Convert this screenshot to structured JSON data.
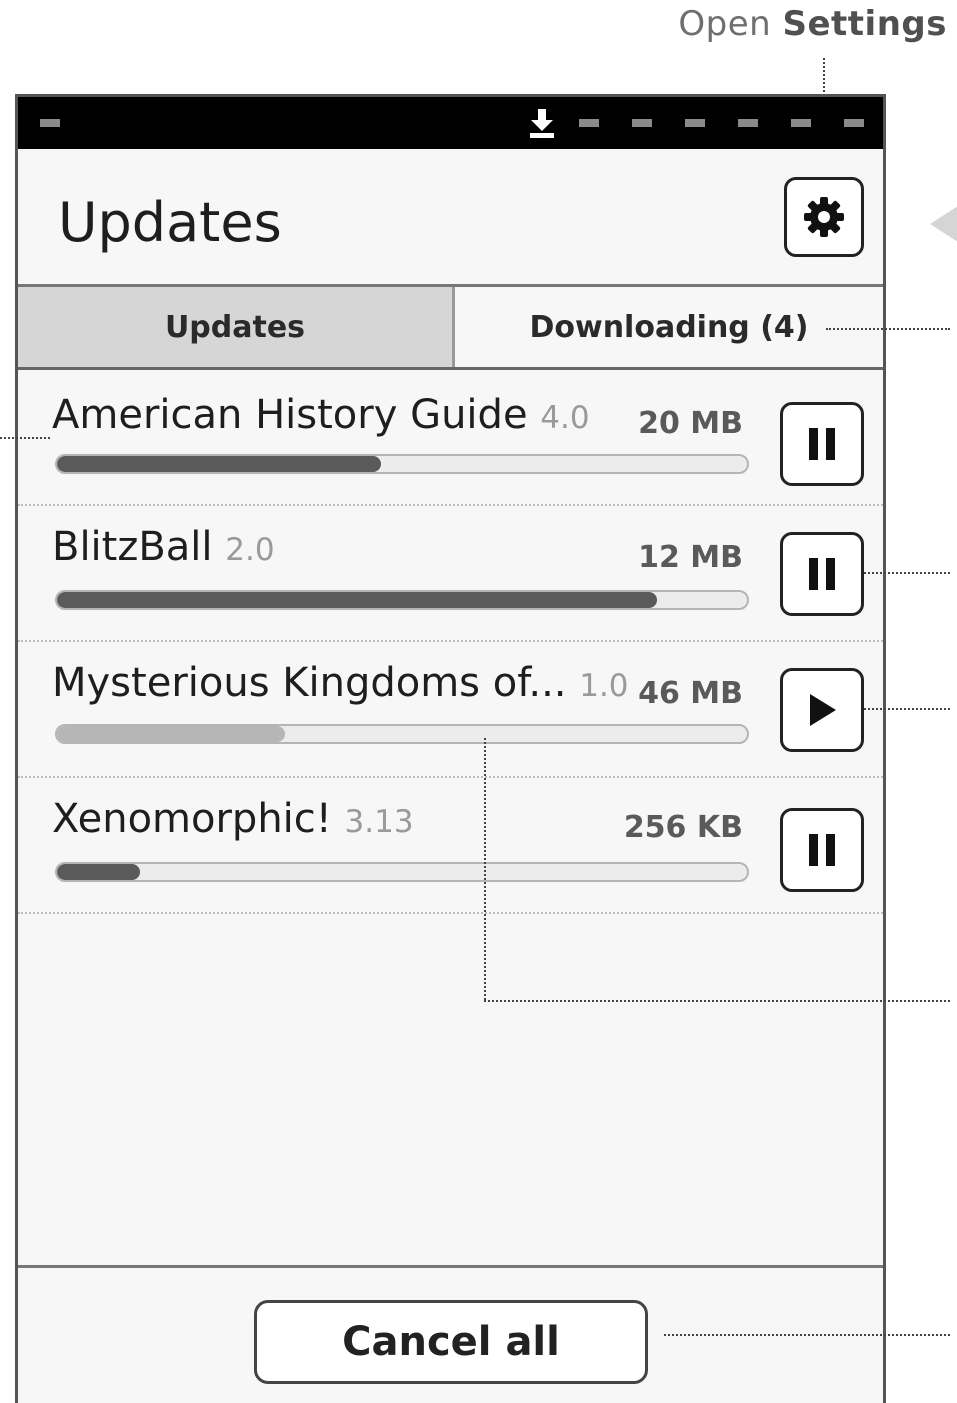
{
  "annotation": {
    "prefix": "Open",
    "emphasis": "Settings"
  },
  "header": {
    "title": "Updates"
  },
  "tabs": [
    {
      "label": "Updates",
      "active": true
    },
    {
      "label": "Downloading (4)",
      "active": false
    }
  ],
  "downloads": [
    {
      "name": "American History Guide",
      "version": "4.0",
      "size": "20 MB",
      "progress": 0.47,
      "state": "pause-icon"
    },
    {
      "name": "BlitzBall",
      "version": "2.0",
      "size": "12 MB",
      "progress": 0.87,
      "state": "pause-icon"
    },
    {
      "name": "Mysterious Kingdoms of...",
      "version": "1.0",
      "size": "46 MB",
      "progress": 0.33,
      "state": "play-icon"
    },
    {
      "name": "Xenomorphic!",
      "version": "3.13",
      "size": "256 KB",
      "progress": 0.12,
      "state": "pause-icon"
    }
  ],
  "footer": {
    "cancel_label": "Cancel all"
  },
  "colors": {
    "statusbar": "#000000",
    "progress": "#5a5a5a",
    "progress_paused": "#b6b6b6",
    "active_tab": "#d6d6d6"
  }
}
